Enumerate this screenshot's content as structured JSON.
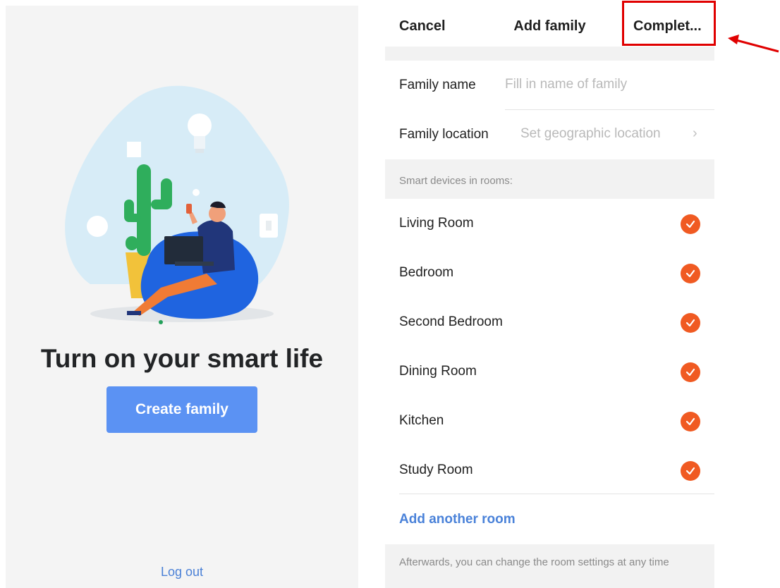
{
  "left_screen": {
    "welcome_title": "Turn on your smart life",
    "create_family_label": "Create family",
    "logout_label": "Log out"
  },
  "right_screen": {
    "nav": {
      "cancel_label": "Cancel",
      "title": "Add family",
      "complete_label": "Complet..."
    },
    "family_name": {
      "label": "Family name",
      "placeholder": "Fill in name of family"
    },
    "family_location": {
      "label": "Family location",
      "placeholder": "Set geographic location"
    },
    "rooms_section_header": "Smart devices in rooms:",
    "rooms": [
      {
        "name": "Living Room",
        "checked": true
      },
      {
        "name": "Bedroom",
        "checked": true
      },
      {
        "name": "Second Bedroom",
        "checked": true
      },
      {
        "name": "Dining Room",
        "checked": true
      },
      {
        "name": "Kitchen",
        "checked": true
      },
      {
        "name": "Study Room",
        "checked": true
      }
    ],
    "add_room_label": "Add another room",
    "footer_note": "Afterwards, you can change the room settings at any time"
  },
  "icons": {
    "check": "check-circle-icon",
    "chevron": "chevron-right-icon",
    "arrow": "red-arrow-annotation"
  },
  "colors": {
    "primary_button": "#5b92f3",
    "link": "#4a82d9",
    "check": "#f05a22",
    "annotation": "#e00000"
  }
}
